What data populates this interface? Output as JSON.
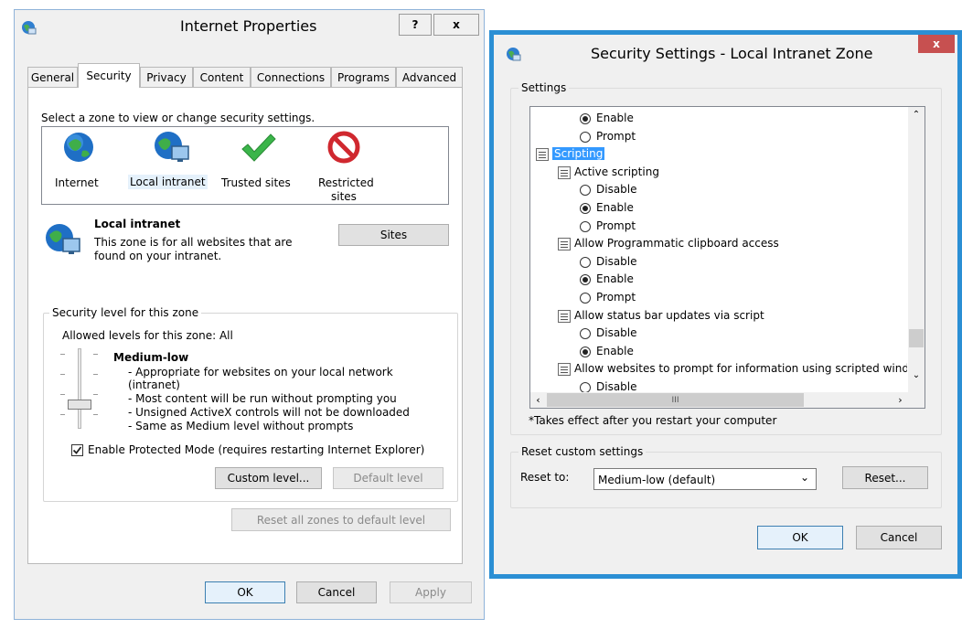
{
  "ip": {
    "title": "Internet Properties",
    "help_label": "?",
    "close_label": "x",
    "tabs": [
      "General",
      "Security",
      "Privacy",
      "Content",
      "Connections",
      "Programs",
      "Advanced"
    ],
    "select_zone_text": "Select a zone to view or change security settings.",
    "zones": [
      {
        "label": "Internet",
        "icon": "globe-icon"
      },
      {
        "label": "Local intranet",
        "icon": "intranet-globe-icon"
      },
      {
        "label": "Trusted sites",
        "icon": "checkmark-icon"
      },
      {
        "label_line1": "Restricted",
        "label_line2": "sites",
        "icon": "no-entry-icon"
      }
    ],
    "zone_title": "Local intranet",
    "zone_desc_line1": "This zone is for all websites that are",
    "zone_desc_line2": "found on your intranet.",
    "sites_button": "Sites",
    "level_group_label": "Security level for this zone",
    "allowed_levels": "Allowed levels for this zone: All",
    "level_name": "Medium-low",
    "level_bullets": [
      "- Appropriate for websites on your local network",
      "(intranet)",
      "- Most content will be run without prompting you",
      "- Unsigned ActiveX controls will not be downloaded",
      "- Same as Medium level without prompts"
    ],
    "protected_mode_label": "Enable Protected Mode (requires restarting Internet Explorer)",
    "protected_mode_checked": true,
    "custom_level_button": "Custom level...",
    "default_level_button": "Default level",
    "reset_all_button": "Reset all zones to default level",
    "ok_button": "OK",
    "cancel_button": "Cancel",
    "apply_button": "Apply"
  },
  "ss": {
    "title": "Security Settings - Local Intranet Zone",
    "close_label": "x",
    "settings_label": "Settings",
    "tree": [
      {
        "type": "radio",
        "label": "Enable",
        "checked": true
      },
      {
        "type": "radio",
        "label": "Prompt",
        "checked": false
      },
      {
        "type": "category",
        "label": "Scripting"
      },
      {
        "type": "setting",
        "label": "Active scripting"
      },
      {
        "type": "radio",
        "label": "Disable",
        "checked": false
      },
      {
        "type": "radio",
        "label": "Enable",
        "checked": true
      },
      {
        "type": "radio",
        "label": "Prompt",
        "checked": false
      },
      {
        "type": "setting",
        "label": "Allow Programmatic clipboard access"
      },
      {
        "type": "radio",
        "label": "Disable",
        "checked": false
      },
      {
        "type": "radio",
        "label": "Enable",
        "checked": true
      },
      {
        "type": "radio",
        "label": "Prompt",
        "checked": false
      },
      {
        "type": "setting",
        "label": "Allow status bar updates via script"
      },
      {
        "type": "radio",
        "label": "Disable",
        "checked": false
      },
      {
        "type": "radio",
        "label": "Enable",
        "checked": true
      },
      {
        "type": "setting",
        "label": "Allow websites to prompt for information using scripted windo"
      },
      {
        "type": "radio",
        "label": "Disable",
        "checked": false
      }
    ],
    "hscroll_thumb_label": "III",
    "note": "*Takes effect after you restart your computer",
    "reset_group_label": "Reset custom settings",
    "reset_to_label": "Reset to:",
    "reset_select_value": "Medium-low (default)",
    "reset_button": "Reset...",
    "ok_button": "OK",
    "cancel_button": "Cancel"
  },
  "colors": {
    "accent_border": "#8fb3d9",
    "right_window_bg": "#2b8fd4",
    "selection": "#3399ff",
    "close_red": "#c75050"
  }
}
